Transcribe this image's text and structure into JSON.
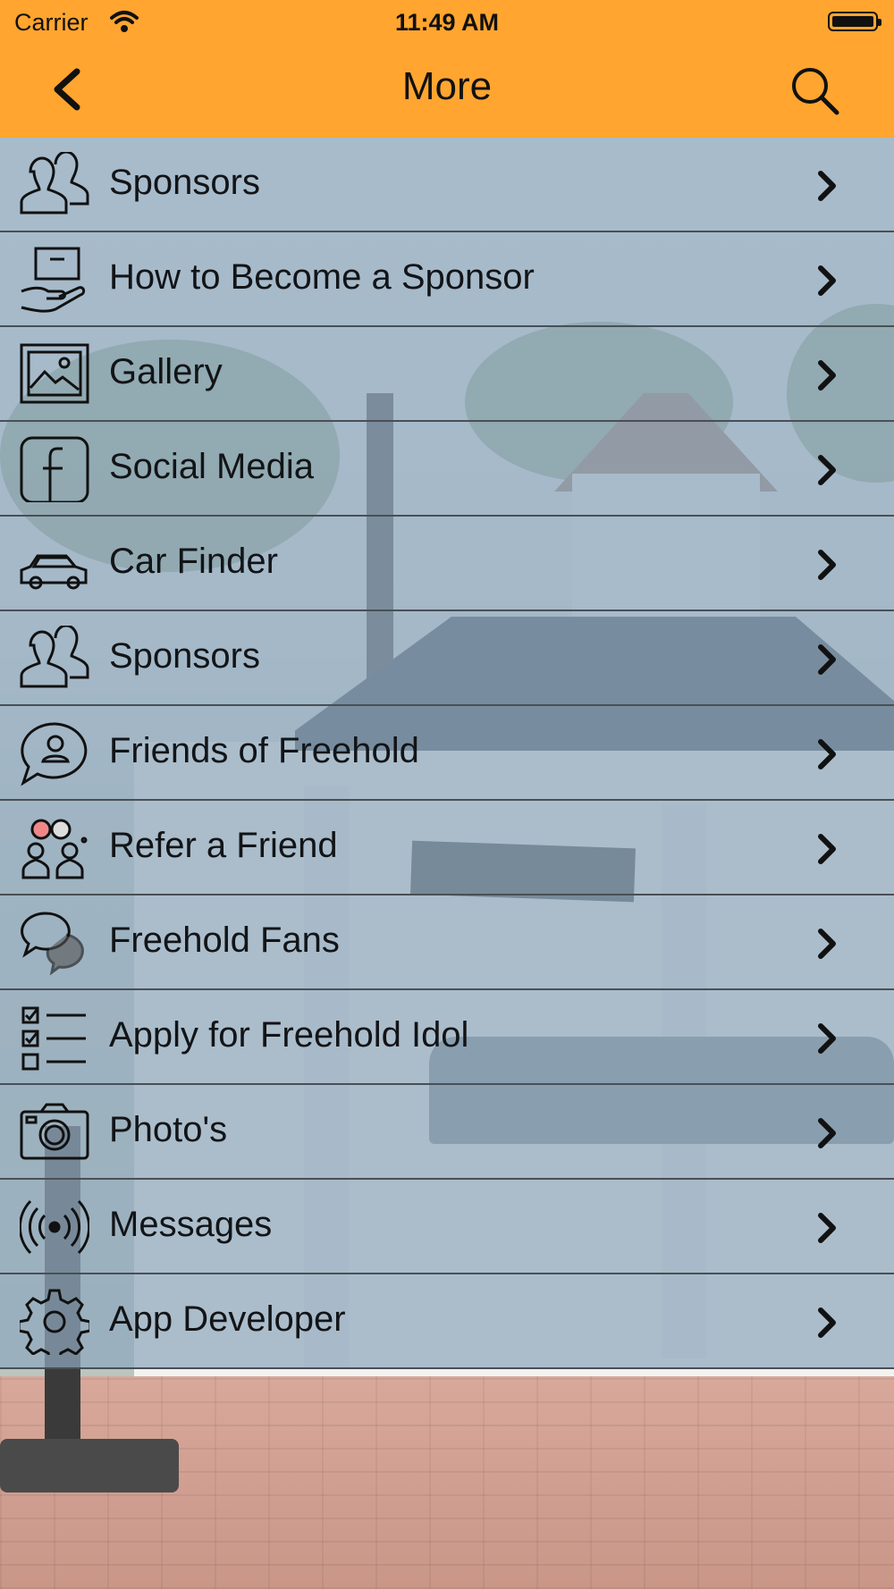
{
  "status_bar": {
    "carrier": "Carrier",
    "time": "11:49 AM"
  },
  "nav": {
    "title": "More",
    "back_icon": "chevron-left-icon",
    "search_icon": "search-icon",
    "background_color": "#ffa530"
  },
  "menu": {
    "items": [
      {
        "label": "Sponsors",
        "icon": "people-icon"
      },
      {
        "label": "How to Become a Sponsor",
        "icon": "hand-box-icon"
      },
      {
        "label": "Gallery",
        "icon": "picture-icon"
      },
      {
        "label": "Social Media",
        "icon": "facebook-icon"
      },
      {
        "label": "Car Finder",
        "icon": "car-icon"
      },
      {
        "label": "Sponsors",
        "icon": "people-icon"
      },
      {
        "label": "Friends of Freehold",
        "icon": "person-bubble-icon"
      },
      {
        "label": "Refer a Friend",
        "icon": "refer-friends-icon"
      },
      {
        "label": "Freehold Fans",
        "icon": "chat-bubbles-icon"
      },
      {
        "label": "Apply for Freehold Idol",
        "icon": "checklist-icon"
      },
      {
        "label": "Photo's",
        "icon": "camera-icon"
      },
      {
        "label": "Messages",
        "icon": "broadcast-icon"
      },
      {
        "label": "App Developer",
        "icon": "gear-icon"
      }
    ]
  }
}
